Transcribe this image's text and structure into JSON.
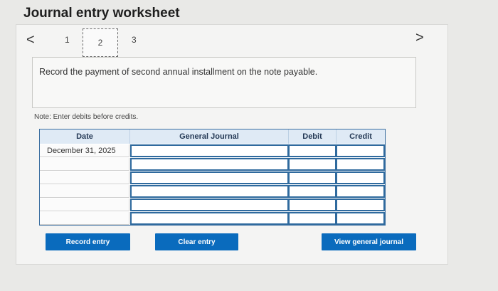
{
  "title": "Journal entry worksheet",
  "nav": {
    "prev": "<",
    "next": ">"
  },
  "pages": [
    "1",
    "2",
    "3"
  ],
  "current_page": "2",
  "instruction": "Record the payment of second annual installment on the note payable.",
  "note": "Note: Enter debits before credits.",
  "journal": {
    "headers": {
      "date": "Date",
      "general_journal": "General Journal",
      "debit": "Debit",
      "credit": "Credit"
    },
    "rows": [
      {
        "date": "December 31, 2025",
        "account": "",
        "debit": "",
        "credit": ""
      },
      {
        "date": "",
        "account": "",
        "debit": "",
        "credit": ""
      },
      {
        "date": "",
        "account": "",
        "debit": "",
        "credit": ""
      },
      {
        "date": "",
        "account": "",
        "debit": "",
        "credit": ""
      },
      {
        "date": "",
        "account": "",
        "debit": "",
        "credit": ""
      },
      {
        "date": "",
        "account": "",
        "debit": "",
        "credit": ""
      }
    ]
  },
  "buttons": {
    "record": "Record entry",
    "clear": "Clear entry",
    "view": "View general journal"
  },
  "colors": {
    "button": "#0a6bbd",
    "header_bg": "#dfeaf5",
    "input_border": "#2f6a9e"
  }
}
